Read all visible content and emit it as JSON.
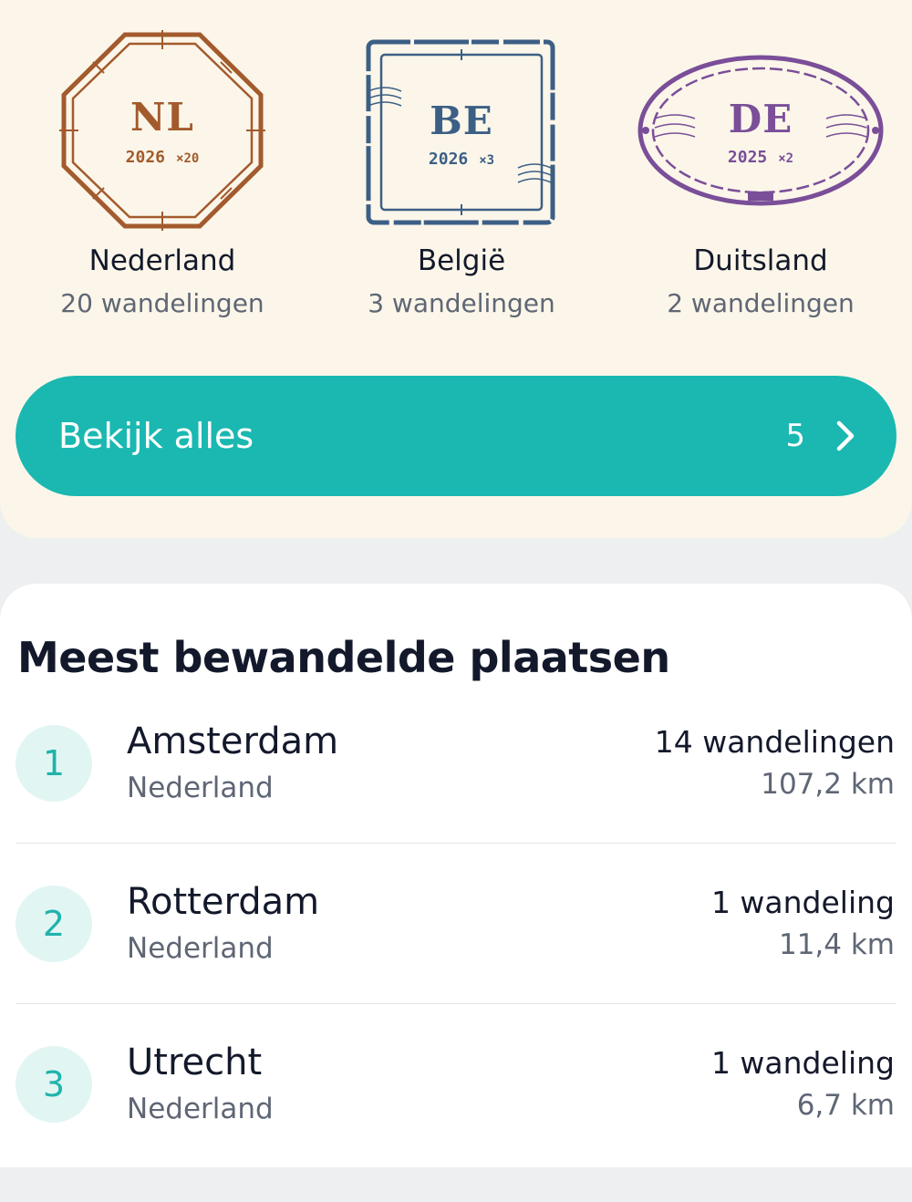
{
  "countries": [
    {
      "code": "NL",
      "year": "2026",
      "multiplier": "×20",
      "name": "Nederland",
      "count": "20 wandelingen",
      "color": "#a35a2d"
    },
    {
      "code": "BE",
      "year": "2026",
      "multiplier": "×3",
      "name": "België",
      "count": "3 wandelingen",
      "color": "#3c5f86"
    },
    {
      "code": "DE",
      "year": "2025",
      "multiplier": "×2",
      "name": "Duitsland",
      "count": "2 wandelingen",
      "color": "#7a4e98"
    }
  ],
  "view_all": {
    "label": "Bekijk alles",
    "count": "5",
    "icon": "chevron-right-icon"
  },
  "section": {
    "title": "Meest bewandelde plaatsen"
  },
  "places": [
    {
      "rank": "1",
      "name": "Amsterdam",
      "country": "Nederland",
      "walks": "14 wandelingen",
      "distance": "107,2 km"
    },
    {
      "rank": "2",
      "name": "Rotterdam",
      "country": "Nederland",
      "walks": "1 wandeling",
      "distance": "11,4 km"
    },
    {
      "rank": "3",
      "name": "Utrecht",
      "country": "Nederland",
      "walks": "1 wandeling",
      "distance": "6,7 km"
    }
  ],
  "colors": {
    "accent": "#1ab8b1",
    "badge_bg": "#e1f6f3",
    "top_bg": "#fbf6e9"
  }
}
